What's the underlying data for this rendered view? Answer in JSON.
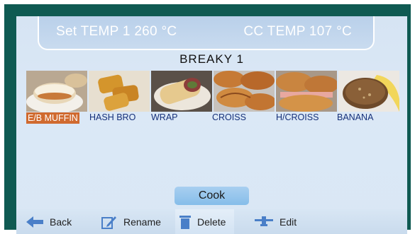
{
  "header": {
    "set_temp": "Set TEMP 1 260 °C",
    "cc_temp": "CC TEMP 107 °C"
  },
  "menu": {
    "title": "BREAKY 1"
  },
  "items": [
    {
      "label": "E/B MUFFIN",
      "selected": true
    },
    {
      "label": "HASH BRO",
      "selected": false
    },
    {
      "label": "WRAP",
      "selected": false
    },
    {
      "label": "CROISS",
      "selected": false
    },
    {
      "label": "H/CROISS",
      "selected": false
    },
    {
      "label": "BANANA",
      "selected": false
    }
  ],
  "actions": {
    "cook": "Cook"
  },
  "toolbar": {
    "back": "Back",
    "rename": "Rename",
    "delete": "Delete",
    "edit": "Edit"
  },
  "colors": {
    "frame": "#0f5a52",
    "screen": "#d9e7f5",
    "selected_label": "#d06a2f",
    "label_text": "#15307a",
    "icon_blue": "#4a7fc8"
  }
}
